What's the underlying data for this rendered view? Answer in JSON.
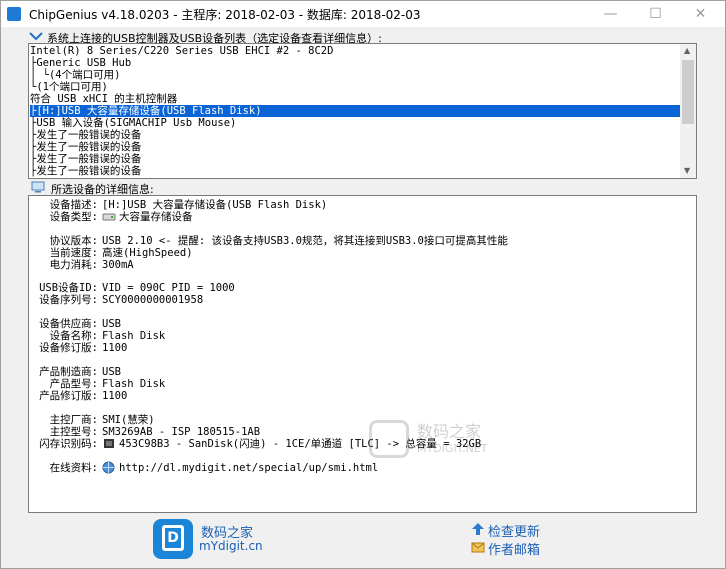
{
  "window": {
    "title": "ChipGenius v4.18.0203 - 主程序: 2018-02-03 - 数据库: 2018-02-03",
    "minimize": "—",
    "maximize": "☐",
    "close": "✕"
  },
  "device_list": {
    "label": "系统上连接的USB控制器及USB设备列表（选定设备查看详细信息）:",
    "items": [
      "Intel(R) 8 Series/C220 Series USB EHCI #2 - 8C2D",
      "├Generic USB Hub",
      "│ └(4个端口可用)",
      "└(1个端口可用)",
      "符合 USB xHCI 的主机控制器",
      "├[H:]USB 大容量存储设备(USB Flash Disk)",
      "├USB 输入设备(SIGMACHIP Usb Mouse)",
      "├发生了一般错误的设备",
      "├发生了一般错误的设备",
      "├发生了一般错误的设备",
      "├发生了一般错误的设备",
      "└发生了一般错误的设备"
    ],
    "selected_index": 5
  },
  "details": {
    "label": "所选设备的详细信息:",
    "rows": [
      {
        "k": "设备描述:",
        "v": "[H:]USB 大容量存储设备(USB Flash Disk)"
      },
      {
        "k": "设备类型:",
        "v": "大容量存储设备"
      },
      {
        "k": "协议版本:",
        "v": "USB 2.10 <- 提醒: 该设备支持USB3.0规范，将其连接到USB3.0接口可提高其性能"
      },
      {
        "k": "当前速度:",
        "v": "高速(HighSpeed)"
      },
      {
        "k": "电力消耗:",
        "v": "300mA"
      },
      {
        "k": "USB设备ID:",
        "v": "VID = 090C PID = 1000"
      },
      {
        "k": "设备序列号:",
        "v": "SCY0000000001958"
      },
      {
        "k": "设备供应商:",
        "v": "USB"
      },
      {
        "k": "设备名称:",
        "v": "Flash Disk"
      },
      {
        "k": "设备修订版:",
        "v": "1100"
      },
      {
        "k": "产品制造商:",
        "v": "USB"
      },
      {
        "k": "产品型号:",
        "v": "Flash Disk"
      },
      {
        "k": "产品修订版:",
        "v": "1100"
      },
      {
        "k": "主控厂商:",
        "v": "SMI(慧荣)"
      },
      {
        "k": "主控型号:",
        "v": "SM3269AB - ISP 180515-1AB"
      },
      {
        "k": "闪存识别码:",
        "v": "453C98B3 - SanDisk(闪迪) - 1CE/单通道 [TLC] -> 总容量 = 32GB"
      },
      {
        "k": "在线资料:",
        "v": "http://dl.mydigit.net/special/up/smi.html"
      }
    ]
  },
  "footer": {
    "logo_char": "D",
    "site_name": "数码之家",
    "site_url": "mYdigit.cn",
    "check_update": "检查更新",
    "author_mail": "作者邮箱"
  },
  "watermark": {
    "line1": "数码之家",
    "line2": "MYDIGIT.NET"
  },
  "colors": {
    "selection": "#0a64d6",
    "link": "#1a5fb4"
  }
}
